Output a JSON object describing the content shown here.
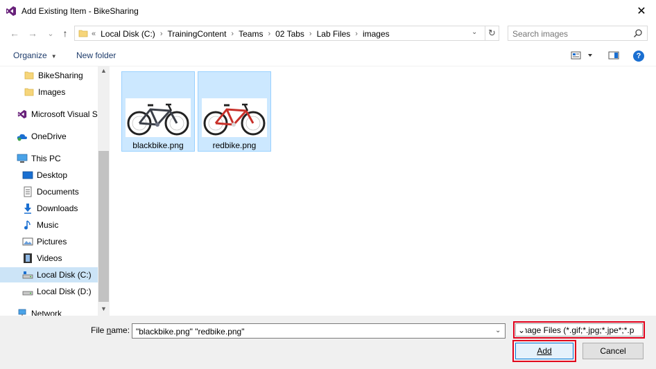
{
  "window": {
    "title": "Add Existing Item - BikeSharing",
    "close_glyph": "✕",
    "app_icon": "visual-studio-icon"
  },
  "nav": {
    "back_glyph": "←",
    "forward_glyph": "→",
    "recent_glyph": "⌄",
    "up_glyph": "↑",
    "breadcrumb_prefix": "«",
    "breadcrumbs": [
      "Local Disk (C:)",
      "TrainingContent",
      "Teams",
      "02 Tabs",
      "Lab Files",
      "images"
    ],
    "refresh_glyph": "↻",
    "search_placeholder": "Search images"
  },
  "toolbar": {
    "organize_label": "Organize",
    "new_folder_label": "New folder",
    "help_glyph": "?"
  },
  "navpane": {
    "items": [
      {
        "label": "BikeSharing",
        "icon": "folder-icon"
      },
      {
        "label": "Images",
        "icon": "folder-icon"
      },
      {
        "label": "Microsoft Visual S",
        "icon": "visual-studio-icon"
      },
      {
        "label": "OneDrive",
        "icon": "onedrive-icon"
      },
      {
        "label": "This PC",
        "icon": "computer-icon"
      },
      {
        "label": "Desktop",
        "icon": "desktop-icon"
      },
      {
        "label": "Documents",
        "icon": "documents-icon"
      },
      {
        "label": "Downloads",
        "icon": "downloads-icon"
      },
      {
        "label": "Music",
        "icon": "music-icon"
      },
      {
        "label": "Pictures",
        "icon": "pictures-icon"
      },
      {
        "label": "Videos",
        "icon": "videos-icon"
      },
      {
        "label": "Local Disk (C:)",
        "icon": "drive-icon"
      },
      {
        "label": "Local Disk (D:)",
        "icon": "drive-icon"
      },
      {
        "label": "Network",
        "icon": "network-icon"
      }
    ],
    "selected": "Local Disk (C:)"
  },
  "files": [
    {
      "name": "blackbike.png",
      "frame_color": "#3b3f48",
      "accent_color": "#6b7080"
    },
    {
      "name": "redbike.png",
      "frame_color": "#c8312a",
      "accent_color": "#d9d9d9"
    }
  ],
  "footer": {
    "file_name_label_pre": "File ",
    "file_name_label_u": "n",
    "file_name_label_post": "ame:",
    "file_name_value": "\"blackbike.png\" \"redbike.png\"",
    "filter_value": "Image Files (*.gif;*.jpg;*.jpe*;*.p",
    "add_label": "Add",
    "cancel_label": "Cancel"
  },
  "colors": {
    "highlight": "#e1001b",
    "selection": "#cce8ff",
    "accent": "#0078d7"
  }
}
